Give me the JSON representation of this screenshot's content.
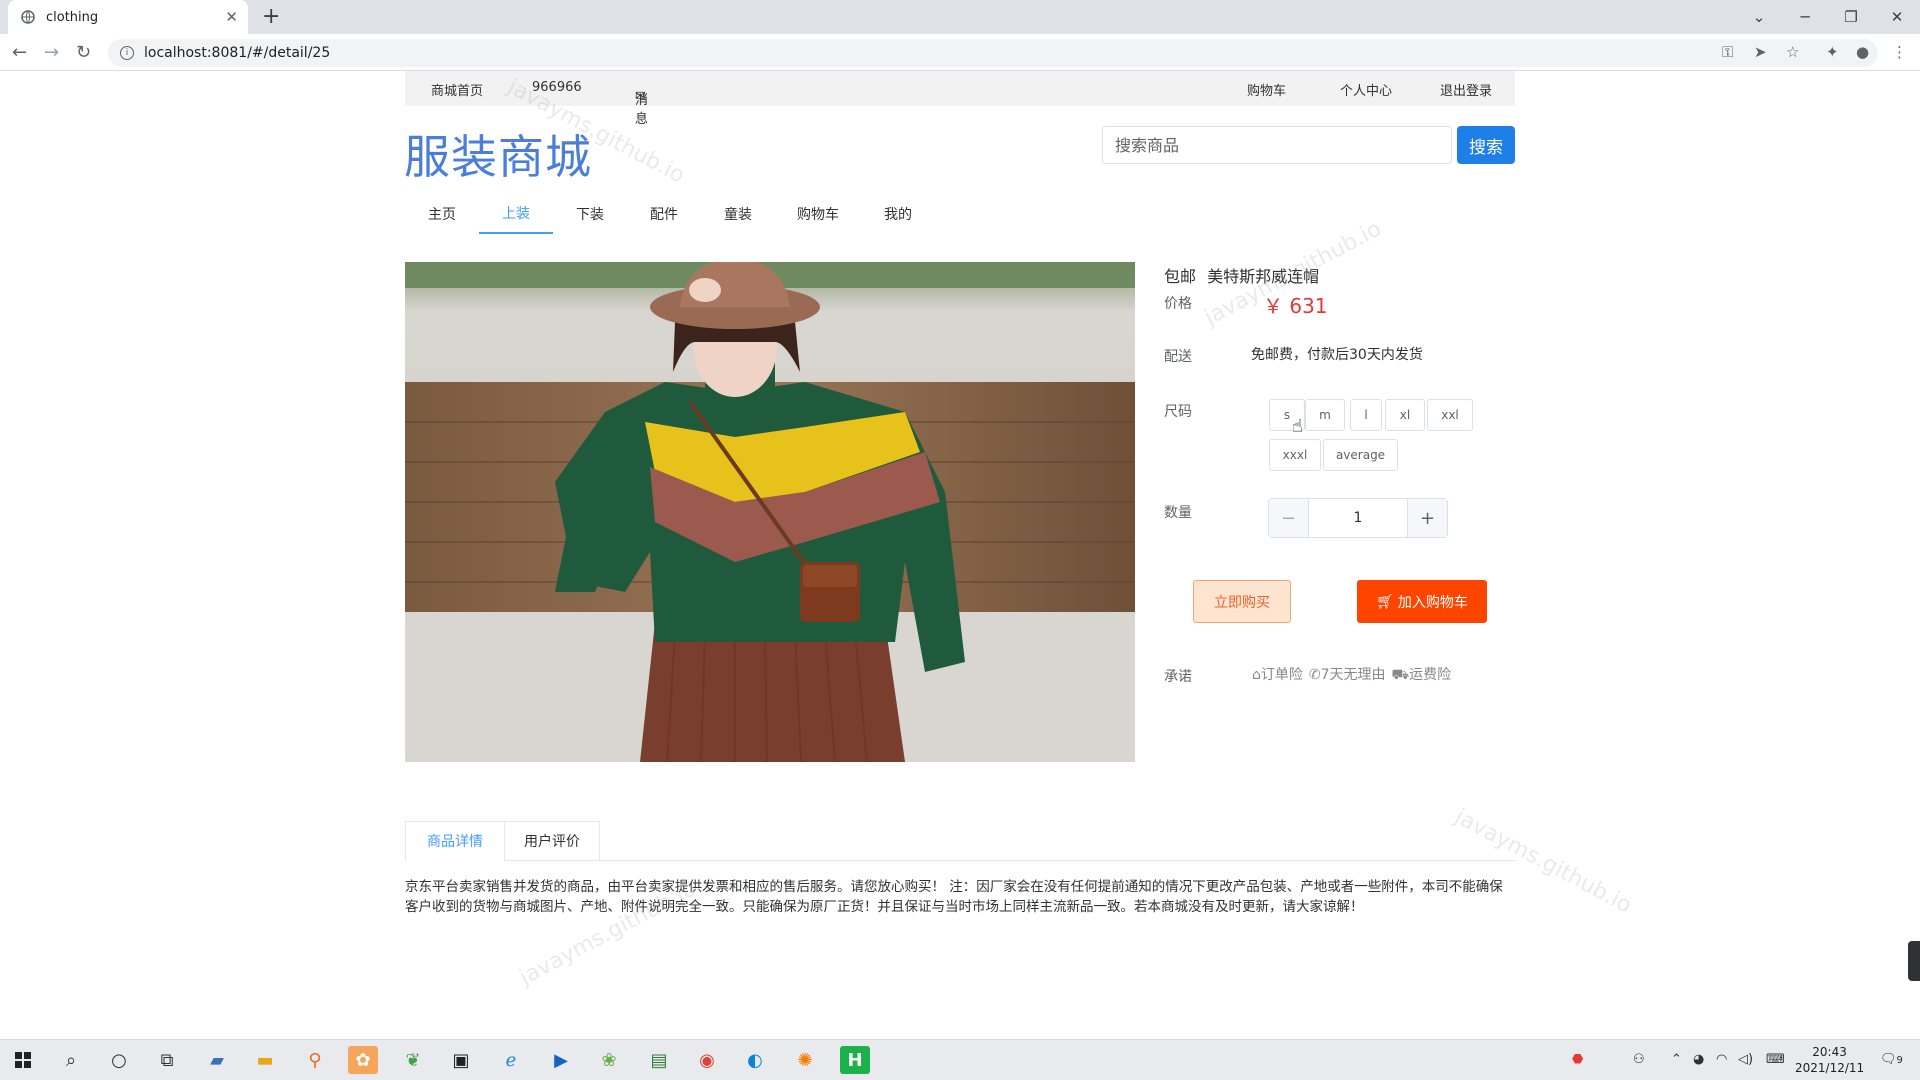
{
  "browser": {
    "tab_title": "clothing",
    "url": "localhost:8081/#/detail/25"
  },
  "topbar": {
    "home": "商城首页",
    "phone": "966966",
    "messages": "消息",
    "cart": "购物车",
    "profile": "个人中心",
    "logout": "退出登录"
  },
  "header": {
    "logo": "服装商城",
    "search_placeholder": "搜索商品",
    "search_button": "搜索"
  },
  "nav": {
    "items": [
      "主页",
      "上装",
      "下装",
      "配件",
      "童装",
      "购物车",
      "我的"
    ],
    "active": "上装"
  },
  "product": {
    "badge": "包邮",
    "name": "美特斯邦威连帽",
    "price_label": "价格",
    "price": "￥ 631",
    "delivery_label": "配送",
    "delivery_text": "免邮费，付款后30天内发货",
    "size_label": "尺码",
    "sizes": [
      "s",
      "m",
      "l",
      "xl",
      "xxl",
      "xxxl",
      "average"
    ],
    "qty_label": "数量",
    "qty_value": "1",
    "qty_minus": "−",
    "qty_plus": "+",
    "buy_now": "立即购买",
    "add_to_cart": "加入购物车",
    "promise_label": "承诺",
    "promises": [
      "订单险",
      "7天无理由",
      "运费险"
    ]
  },
  "tabs": {
    "detail": "商品详情",
    "reviews": "用户评价"
  },
  "description": "京东平台卖家销售并发货的商品，由平台卖家提供发票和相应的售后服务。请您放心购买！ 注：因厂家会在没有任何提前通知的情况下更改产品包装、产地或者一些附件，本司不能确保客户收到的货物与商城图片、产地、附件说明完全一致。只能确保为原厂正货！并且保证与当时市场上同样主流新品一致。若本商城没有及时更新，请大家谅解！",
  "watermark": "javayms.github.io",
  "taskbar": {
    "time": "20:43",
    "date": "2021/12/11",
    "notifications": "9"
  },
  "colors": {
    "accent": "#409eff",
    "price": "#e4393c",
    "cart_button": "#ff4400",
    "logo": "#4a7ed8"
  }
}
